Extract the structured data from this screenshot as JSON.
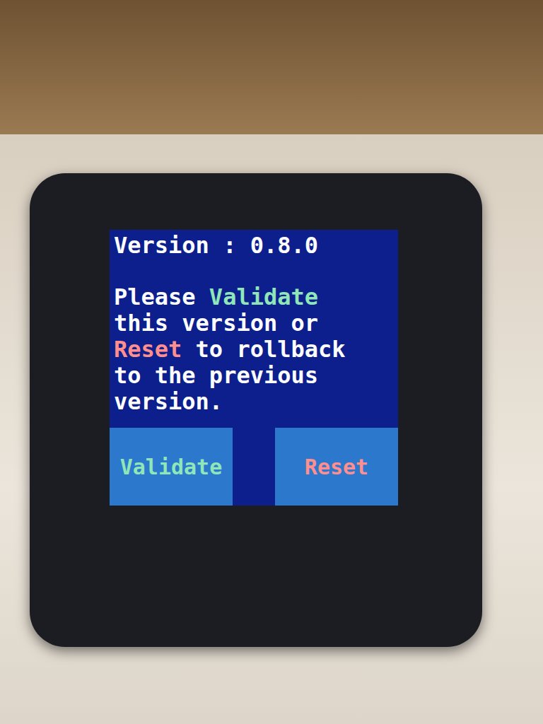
{
  "screen": {
    "version": "Version : 0.8.0",
    "message": [
      {
        "text": "Please ",
        "color": "#ffffff"
      },
      {
        "text": "Validate",
        "color": "#8fe6b8"
      },
      {
        "text": " this version or ",
        "color": "#ffffff"
      },
      {
        "text": "Reset",
        "color": "#ff8f8f"
      },
      {
        "text": " to rollback to the previous version.",
        "color": "#ffffff"
      }
    ],
    "buttons": [
      {
        "label": "Validate",
        "color": "#8fe6b8"
      },
      {
        "label": "Reset",
        "color": "#ff8f8f"
      }
    ]
  }
}
